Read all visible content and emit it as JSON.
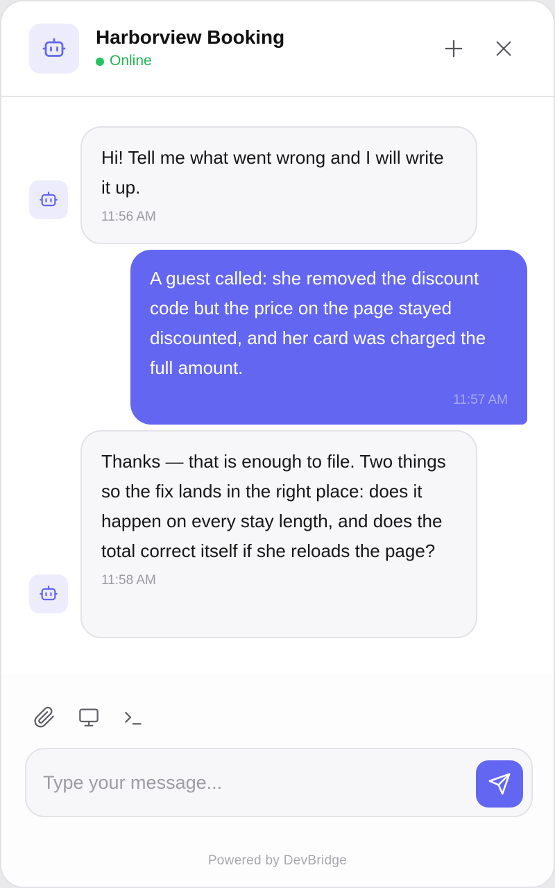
{
  "header": {
    "title": "Harborview Booking",
    "status": "Online",
    "status_color": "#22c55e",
    "avatar_icon": "robot-icon",
    "new_chat_icon": "plus-icon",
    "close_icon": "close-icon"
  },
  "theme": {
    "accent": "#6366f1",
    "bot_bubble": "#f7f7f9",
    "avatar_bg": "#ececfc"
  },
  "messages": [
    {
      "sender": "bot",
      "text": "Hi! Tell me what went wrong and I will write it up.",
      "time": "11:56 AM"
    },
    {
      "sender": "user",
      "text": "A guest called: she removed the discount code but the price on the page stayed discounted, and her card was charged the full amount.",
      "time": "11:57 AM"
    },
    {
      "sender": "bot",
      "text": "Thanks — that is enough to file. Two things so the fix lands in the right place: does it happen on every stay length, and does the total correct itself if she reloads the page?",
      "time": "11:58 AM"
    }
  ],
  "toolbar": {
    "attach_icon": "paperclip-icon",
    "screen_icon": "monitor-icon",
    "terminal_icon": "terminal-icon"
  },
  "composer": {
    "placeholder": "Type your message...",
    "value": "",
    "send_icon": "send-icon"
  },
  "footer": {
    "powered_by": "Powered by DevBridge"
  }
}
